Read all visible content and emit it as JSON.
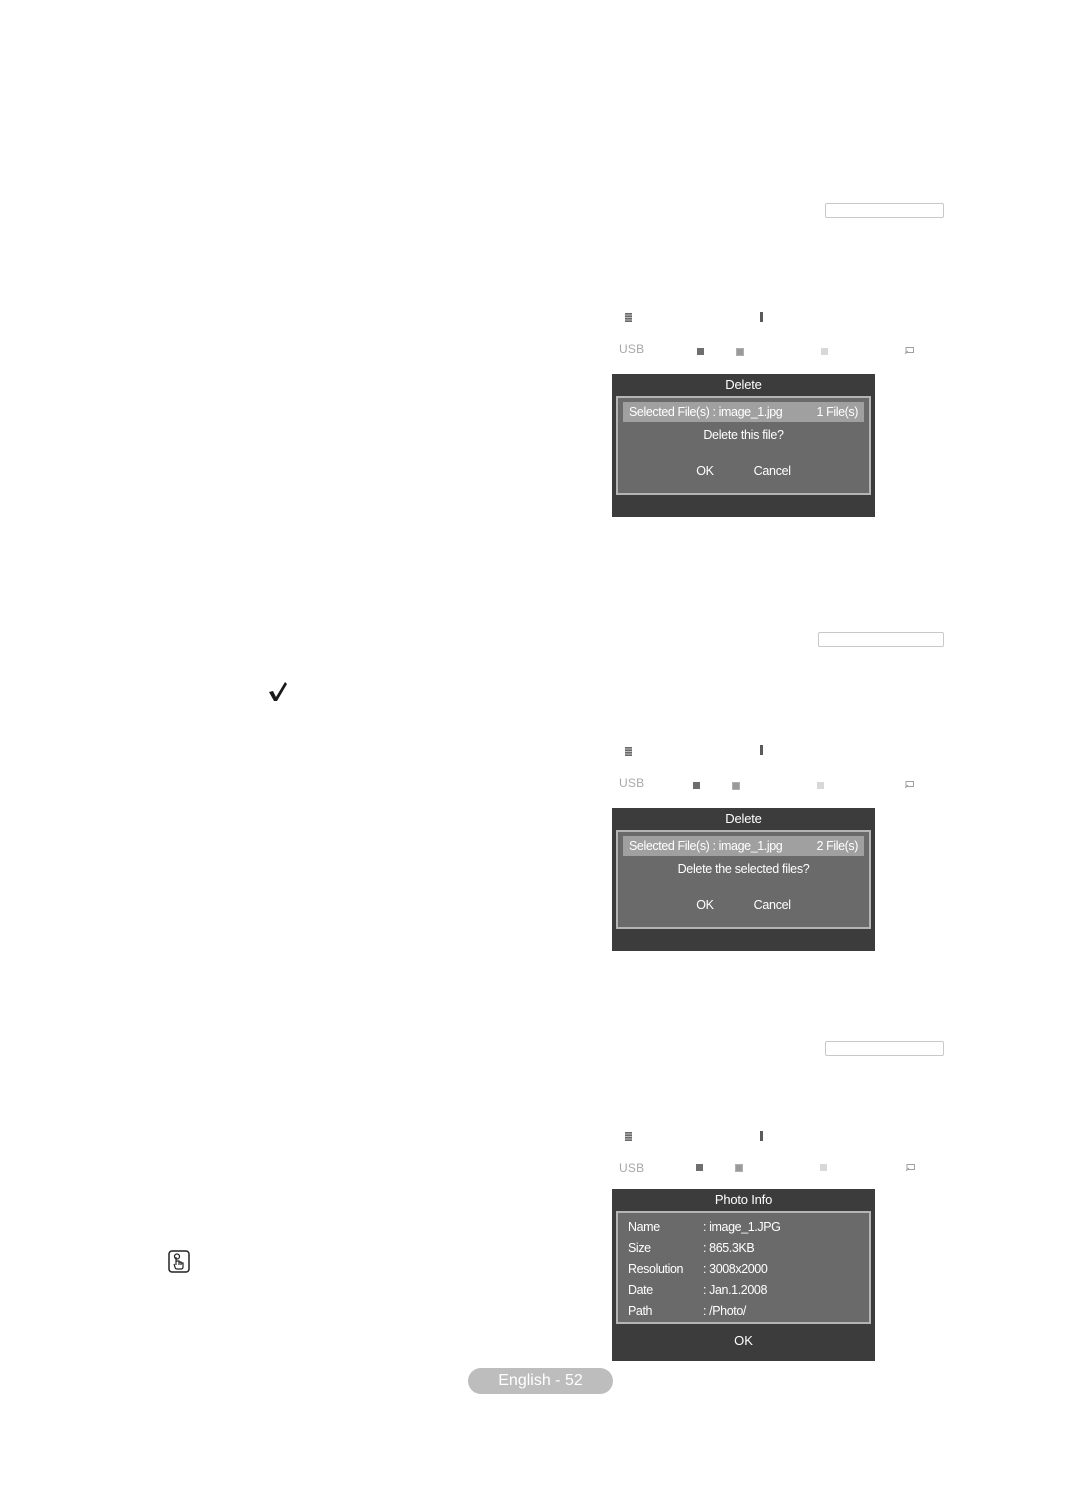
{
  "page": {
    "footer_label": "English - 52"
  },
  "sections": [
    {
      "usb_label": "USB",
      "dialog": {
        "title": "Delete",
        "selected_label": "Selected File(s) : image_1.jpg",
        "file_count": "1 File(s)",
        "question": "Delete this file?",
        "ok_label": "OK",
        "cancel_label": "Cancel"
      }
    },
    {
      "usb_label": "USB",
      "dialog": {
        "title": "Delete",
        "selected_label": "Selected File(s) : image_1.jpg",
        "file_count": "2 File(s)",
        "question": "Delete the selected files?",
        "ok_label": "OK",
        "cancel_label": "Cancel"
      }
    },
    {
      "usb_label": "USB",
      "dialog": {
        "title": "Photo Info",
        "rows": [
          {
            "key": "Name",
            "value": ": image_1.JPG"
          },
          {
            "key": "Size",
            "value": ": 865.3KB"
          },
          {
            "key": "Resolution",
            "value": ": 3008x2000"
          },
          {
            "key": "Date",
            "value": ": Jan.1.2008"
          },
          {
            "key": "Path",
            "value": ": /Photo/"
          }
        ],
        "ok_label": "OK"
      }
    }
  ],
  "icons": {
    "check": "check-mark-icon",
    "note": "hand-pointer-note-icon",
    "menu": "menu-icon",
    "return": "return-icon"
  },
  "colors": {
    "dialog_bg": "#3c3c3c",
    "dialog_inner_bg": "#6a6a6a",
    "selected_row_bg": "#a0a0a0",
    "pill_bg": "#bdbdbd"
  }
}
